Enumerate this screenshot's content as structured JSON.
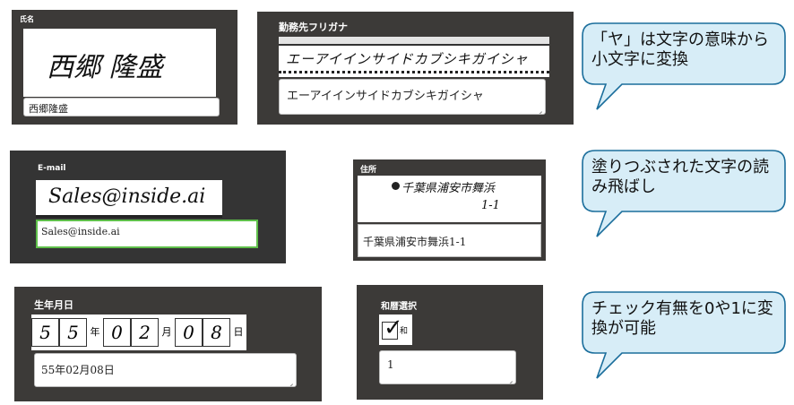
{
  "name_panel": {
    "label": "氏名",
    "handwriting": "西郷 隆盛",
    "value": "西郷隆盛"
  },
  "furigana_panel": {
    "label": "勤務先フリガナ",
    "handwriting": "エーアイインサイドカブシキガイシャ",
    "value": "エーアイインサイドカブシキガイシャ"
  },
  "email_panel": {
    "label": "E-mail",
    "handwriting": "Sales@inside.ai",
    "value": "Sales@inside.ai"
  },
  "address_panel": {
    "label": "住所",
    "handwriting_line1": "千葉県浦安市舞浜",
    "handwriting_line2": "1-1",
    "value": "千葉県浦安市舞浜1-1"
  },
  "birthday_panel": {
    "label": "生年月日",
    "boxes": [
      {
        "hand": "5"
      },
      {
        "hand": "5"
      },
      {
        "print": "年"
      },
      {
        "hand": "0"
      },
      {
        "hand": "2"
      },
      {
        "print": "月"
      },
      {
        "hand": "0"
      },
      {
        "hand": "8"
      },
      {
        "print": "日"
      }
    ],
    "value": "55年02月08日"
  },
  "era_panel": {
    "label": "和暦選択",
    "check_label": "和",
    "value": "1"
  },
  "callouts": [
    {
      "text": "「ヤ」は文字の意味から小文字に変換"
    },
    {
      "text": "塗りつぶされた文字の読み飛ばし"
    },
    {
      "text": "チェック有無を0や1に変換が可能"
    }
  ],
  "colors": {
    "panel_bg": "#3c3a38",
    "bubble_fill": "#d7edf7",
    "bubble_stroke": "#1b6e9c",
    "email_border": "#5fbf4a"
  }
}
